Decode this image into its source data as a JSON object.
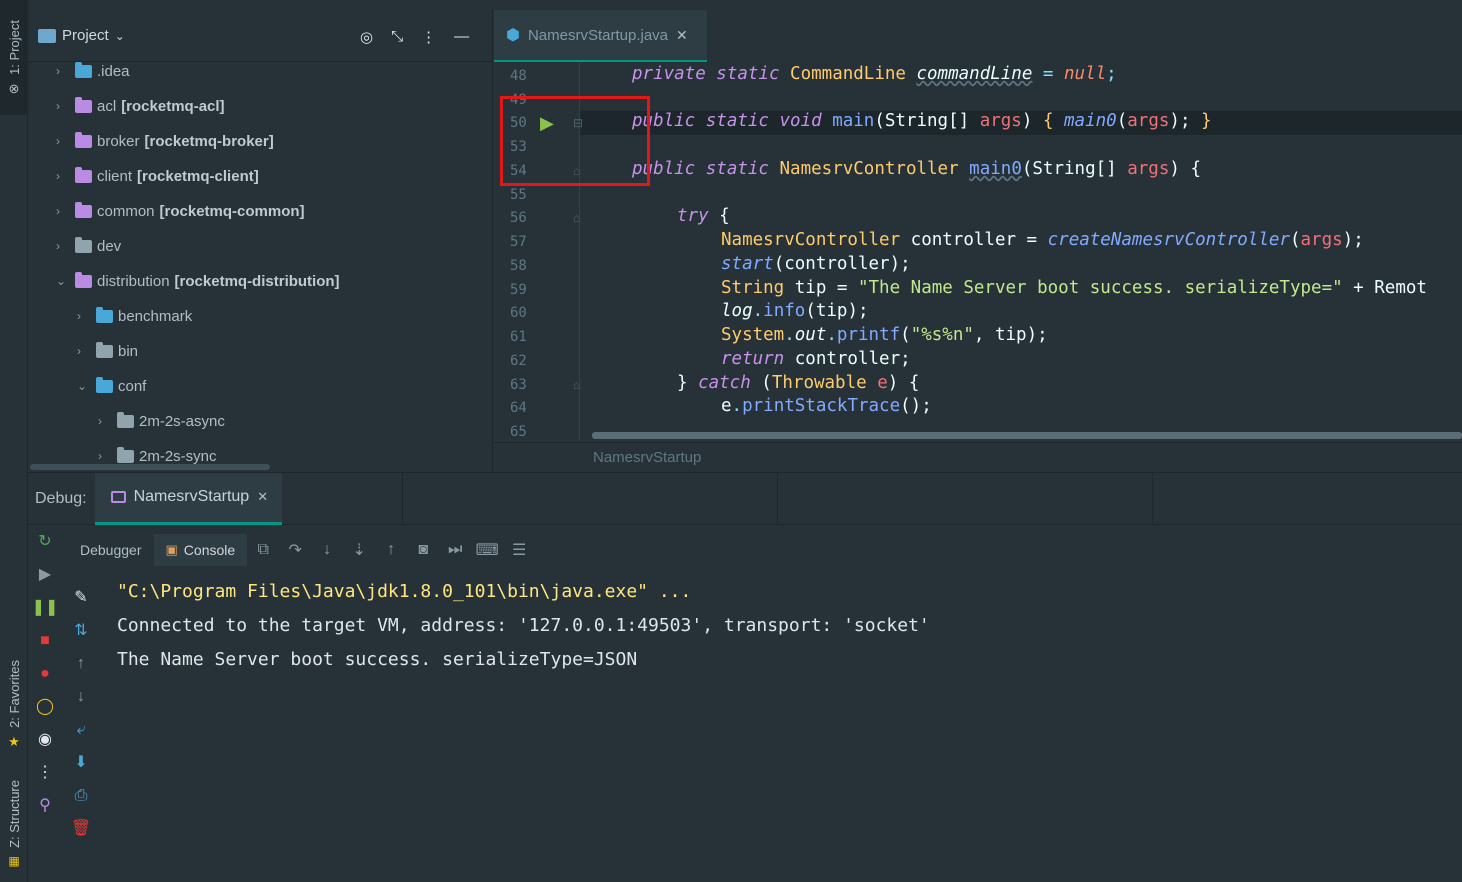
{
  "left_strip": {
    "project_tab": "1: Project",
    "favorites_tab": "2: Favorites",
    "structure_tab": "Z: Structure"
  },
  "project_panel": {
    "title": "Project",
    "tree": [
      {
        "name": ".idea",
        "module": "",
        "level": 0,
        "expanded": false,
        "icon": "folder-special-icon"
      },
      {
        "name": "acl",
        "module": "[rocketmq-acl]",
        "level": 0,
        "expanded": false,
        "icon": "module-folder-icon"
      },
      {
        "name": "broker",
        "module": "[rocketmq-broker]",
        "level": 0,
        "expanded": false,
        "icon": "module-folder-icon"
      },
      {
        "name": "client",
        "module": "[rocketmq-client]",
        "level": 0,
        "expanded": false,
        "icon": "module-folder-icon"
      },
      {
        "name": "common",
        "module": "[rocketmq-common]",
        "level": 0,
        "expanded": false,
        "icon": "module-folder-icon"
      },
      {
        "name": "dev",
        "module": "",
        "level": 0,
        "expanded": false,
        "icon": "folder-icon"
      },
      {
        "name": "distribution",
        "module": "[rocketmq-distribution]",
        "level": 0,
        "expanded": true,
        "icon": "module-folder-icon"
      },
      {
        "name": "benchmark",
        "module": "",
        "level": 1,
        "expanded": false,
        "icon": "folder-special-icon"
      },
      {
        "name": "bin",
        "module": "",
        "level": 1,
        "expanded": false,
        "icon": "folder-icon"
      },
      {
        "name": "conf",
        "module": "",
        "level": 1,
        "expanded": true,
        "icon": "folder-special-icon"
      },
      {
        "name": "2m-2s-async",
        "module": "",
        "level": 2,
        "expanded": false,
        "icon": "folder-icon"
      },
      {
        "name": "2m-2s-sync",
        "module": "",
        "level": 2,
        "expanded": false,
        "icon": "folder-icon"
      }
    ]
  },
  "editor": {
    "tab_label": "NamesrvStartup.java",
    "breadcrumb": "NamesrvStartup",
    "line_numbers": [
      "48",
      "49",
      "50",
      "53",
      "54",
      "55",
      "56",
      "57",
      "58",
      "59",
      "60",
      "61",
      "62",
      "63",
      "64",
      "65"
    ],
    "code": {
      "l48": {
        "kw1": "private static ",
        "type": "CommandLine ",
        "field": "commandLine",
        "rest": " = ",
        "null": "null",
        "semi": ";"
      },
      "l50": {
        "kw1": "public static void ",
        "fn": "main",
        "p1": "(String[] ",
        "args": "args",
        "p2": ") ",
        "br1": "{ ",
        "call": "main0",
        "p3": "(",
        "args2": "args",
        "p4": "); ",
        "br2": "}"
      },
      "l54": {
        "kw1": "public static ",
        "type": "NamesrvController ",
        "fn": "main0",
        "p1": "(String[] ",
        "args": "args",
        "p2": ") {"
      },
      "l56": {
        "kw": "try",
        "rest": " {"
      },
      "l57": {
        "type": "NamesrvController ",
        "var": "controller = ",
        "fn": "createNamesrvController",
        "p1": "(",
        "args": "args",
        "p2": ");"
      },
      "l58": {
        "fn": "start",
        "rest": "(controller);"
      },
      "l59": {
        "type": "String ",
        "var": "tip = ",
        "str": "\"The Name Server boot success. serializeType=\"",
        "rest": " + Remot"
      },
      "l60": {
        "obj": "log",
        "dot": ".",
        "fn": "info",
        "rest": "(tip);"
      },
      "l61": {
        "type": "System",
        "dot": ".",
        "field": "out",
        "dot2": ".",
        "fn": "printf",
        "p1": "(",
        "str": "\"%s%n\"",
        "rest": ", tip);"
      },
      "l62": {
        "kw": "return",
        "rest": " controller;"
      },
      "l63": {
        "br": "} ",
        "kw": "catch",
        "p1": " (",
        "type": "Throwable ",
        "var": "e",
        "p2": ") {"
      },
      "l64": {
        "obj": "e",
        "dot": ".",
        "fn": "printStackTrace",
        "rest": "();"
      }
    }
  },
  "debug": {
    "label": "Debug:",
    "tab_label": "NamesrvStartup",
    "debugger_tab": "Debugger",
    "console_tab": "Console",
    "console_lines": [
      "\"C:\\Program Files\\Java\\jdk1.8.0_101\\bin\\java.exe\" ...",
      "Connected to the target VM, address: '127.0.0.1:49503', transport: 'socket'",
      "The Name Server boot success. serializeType=JSON"
    ]
  }
}
